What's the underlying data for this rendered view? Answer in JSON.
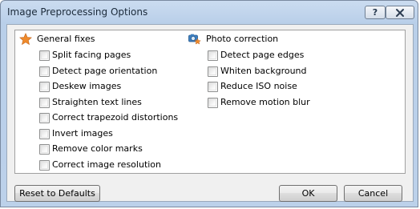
{
  "window": {
    "title": "Image Preprocessing Options",
    "help_label": "?",
    "close_label": "✕"
  },
  "general": {
    "title": "General fixes",
    "icon": "star-icon",
    "icon_color": "#e8862a",
    "options": [
      {
        "label": "Split facing pages",
        "checked": false
      },
      {
        "label": "Detect page orientation",
        "checked": false
      },
      {
        "label": "Deskew images",
        "checked": false
      },
      {
        "label": "Straighten text lines",
        "checked": false
      },
      {
        "label": "Correct trapezoid distortions",
        "checked": false
      },
      {
        "label": "Invert images",
        "checked": false
      },
      {
        "label": "Remove color marks",
        "checked": false
      },
      {
        "label": "Correct image resolution",
        "checked": false
      }
    ]
  },
  "photo": {
    "title": "Photo correction",
    "icon": "camera-star-icon",
    "options": [
      {
        "label": "Detect page edges",
        "checked": false
      },
      {
        "label": "Whiten background",
        "checked": false
      },
      {
        "label": "Reduce ISO noise",
        "checked": false
      },
      {
        "label": "Remove motion blur",
        "checked": false
      }
    ]
  },
  "buttons": {
    "reset": "Reset to Defaults",
    "ok": "OK",
    "cancel": "Cancel"
  }
}
